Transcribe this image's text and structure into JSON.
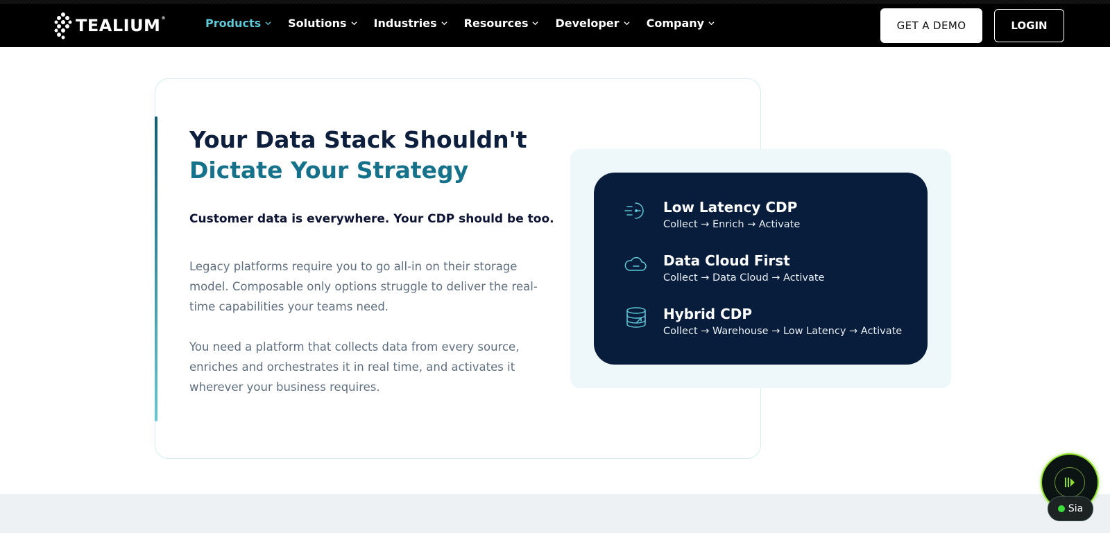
{
  "colors": {
    "accent": "#5cc8d6",
    "teal": "#16718a",
    "navy": "#071d3b",
    "sia_green": "#8ee02a"
  },
  "header": {
    "logo_text": "TEALIUM",
    "logo_icon": "tealium-logo-icon",
    "menu": [
      {
        "label": "Products",
        "active": true
      },
      {
        "label": "Solutions",
        "active": false
      },
      {
        "label": "Industries",
        "active": false
      },
      {
        "label": "Resources",
        "active": false
      },
      {
        "label": "Developer",
        "active": false
      },
      {
        "label": "Company",
        "active": false
      }
    ],
    "demo_label": "GET A DEMO",
    "login_label": "LOGIN"
  },
  "main": {
    "headline_line1": "Your Data Stack Shouldn't",
    "headline_line2": "Dictate Your Strategy",
    "subhead": "Customer data is everywhere. Your CDP should be too.",
    "paragraph1": "Legacy platforms require you to go all-in on their storage model. Composable only options struggle to deliver the real-time capabilities your teams need.",
    "paragraph2": "You need a platform that collects data from every source, enriches and orchestrates it in real time, and activates it wherever your business requires."
  },
  "features": [
    {
      "title": "Low Latency CDP",
      "subtitle": "Collect → Enrich → Activate",
      "icon": "speed-clock-icon"
    },
    {
      "title": "Data Cloud First",
      "subtitle": "Collect → Data Cloud → Activate",
      "icon": "cloud-icon"
    },
    {
      "title": "Hybrid CDP",
      "subtitle": "Collect → Warehouse → Low Latency → Activate",
      "icon": "database-icon"
    }
  ],
  "widget": {
    "label": "Sia"
  }
}
